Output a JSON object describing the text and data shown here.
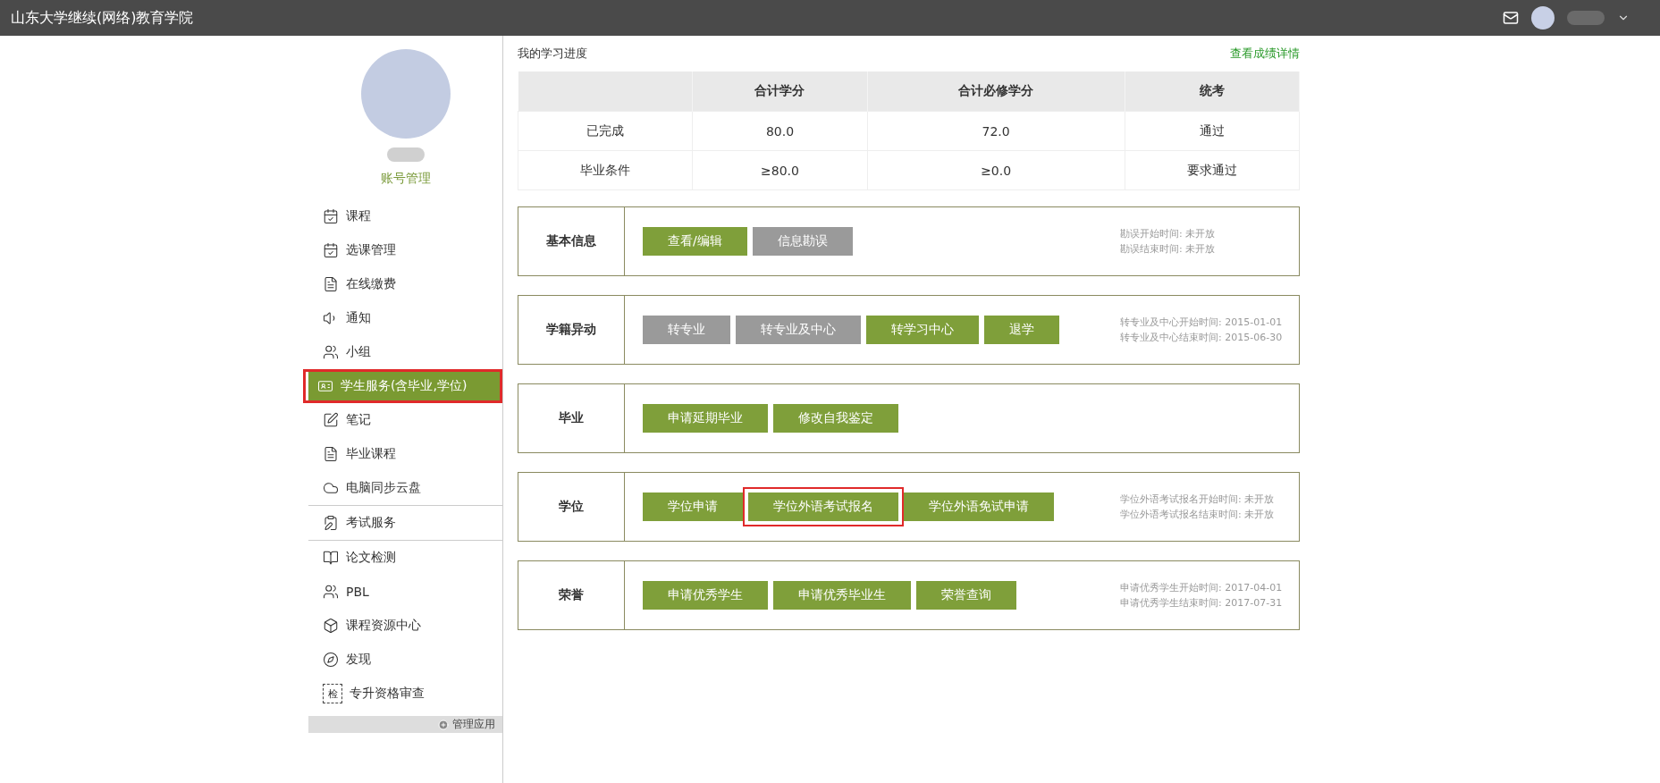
{
  "header": {
    "title": "山东大学继续(网络)教育学院"
  },
  "sidebar": {
    "account_link": "账号管理",
    "items": [
      {
        "label": "课程",
        "selected": false,
        "highlighted": false,
        "separated": false,
        "kind": "calendar"
      },
      {
        "label": "选课管理",
        "selected": false,
        "highlighted": false,
        "separated": false,
        "kind": "calendar"
      },
      {
        "label": "在线缴费",
        "selected": false,
        "highlighted": false,
        "separated": false,
        "kind": "list"
      },
      {
        "label": "通知",
        "selected": false,
        "highlighted": false,
        "separated": false,
        "kind": "speaker"
      },
      {
        "label": "小组",
        "selected": false,
        "highlighted": false,
        "separated": false,
        "kind": "users"
      },
      {
        "label": "学生服务(含毕业,学位)",
        "selected": true,
        "highlighted": true,
        "separated": false,
        "kind": "card"
      },
      {
        "label": "笔记",
        "selected": false,
        "highlighted": false,
        "separated": false,
        "kind": "note"
      },
      {
        "label": "毕业课程",
        "selected": false,
        "highlighted": false,
        "separated": false,
        "kind": "list"
      },
      {
        "label": "电脑同步云盘",
        "selected": false,
        "highlighted": false,
        "separated": false,
        "kind": "cloud"
      },
      {
        "label": "考试服务",
        "selected": false,
        "highlighted": false,
        "separated": true,
        "kind": "exam"
      },
      {
        "label": "论文检测",
        "selected": false,
        "highlighted": false,
        "separated": false,
        "kind": "book"
      },
      {
        "label": "PBL",
        "selected": false,
        "highlighted": false,
        "separated": false,
        "kind": "team"
      },
      {
        "label": "课程资源中心",
        "selected": false,
        "highlighted": false,
        "separated": false,
        "kind": "box"
      },
      {
        "label": "发现",
        "selected": false,
        "highlighted": false,
        "separated": false,
        "kind": "compass"
      },
      {
        "label": "专升资格审查",
        "selected": false,
        "highlighted": false,
        "separated": false,
        "kind": "stamp",
        "icon_text": "检"
      }
    ],
    "manage_button": "管理应用"
  },
  "progress": {
    "title": "我的学习进度",
    "details_link": "查看成绩详情",
    "columns": [
      "合计学分",
      "合计必修学分",
      "统考"
    ],
    "rows": [
      {
        "label": "已完成",
        "cells": [
          "80.0",
          "72.0",
          "通过"
        ]
      },
      {
        "label": "毕业条件",
        "cells": [
          "≥80.0",
          "≥0.0",
          "要求通过"
        ]
      }
    ]
  },
  "sections": [
    {
      "title": "基本信息",
      "buttons": [
        {
          "label": "查看/编辑",
          "disabled": false,
          "highlighted": false
        },
        {
          "label": "信息勘误",
          "disabled": true,
          "highlighted": false
        }
      ],
      "notes": [
        "勘误开始时间: 未开放",
        "勘误结束时间: 未开放"
      ]
    },
    {
      "title": "学籍异动",
      "buttons": [
        {
          "label": "转专业",
          "disabled": true,
          "highlighted": false
        },
        {
          "label": "转专业及中心",
          "disabled": true,
          "highlighted": false
        },
        {
          "label": "转学习中心",
          "disabled": false,
          "highlighted": false
        },
        {
          "label": "退学",
          "disabled": false,
          "highlighted": false
        }
      ],
      "notes": [
        "转专业及中心开始时间: 2015-01-01",
        "转专业及中心结束时间: 2015-06-30"
      ]
    },
    {
      "title": "毕业",
      "buttons": [
        {
          "label": "申请延期毕业",
          "disabled": false,
          "highlighted": false
        },
        {
          "label": "修改自我鉴定",
          "disabled": false,
          "highlighted": false
        }
      ]
    },
    {
      "title": "学位",
      "buttons": [
        {
          "label": "学位申请",
          "disabled": false,
          "highlighted": false
        },
        {
          "label": "学位外语考试报名",
          "disabled": false,
          "highlighted": true
        },
        {
          "label": "学位外语免试申请",
          "disabled": false,
          "highlighted": false
        }
      ],
      "notes": [
        "学位外语考试报名开始时间: 未开放",
        "学位外语考试报名结束时间: 未开放"
      ]
    },
    {
      "title": "荣誉",
      "buttons": [
        {
          "label": "申请优秀学生",
          "disabled": false,
          "highlighted": false
        },
        {
          "label": "申请优秀毕业生",
          "disabled": false,
          "highlighted": false
        },
        {
          "label": "荣誉查询",
          "disabled": false,
          "highlighted": false
        }
      ],
      "notes": [
        "申请优秀学生开始时间: 2017-04-01",
        "申请优秀学生结束时间: 2017-07-31"
      ]
    }
  ]
}
